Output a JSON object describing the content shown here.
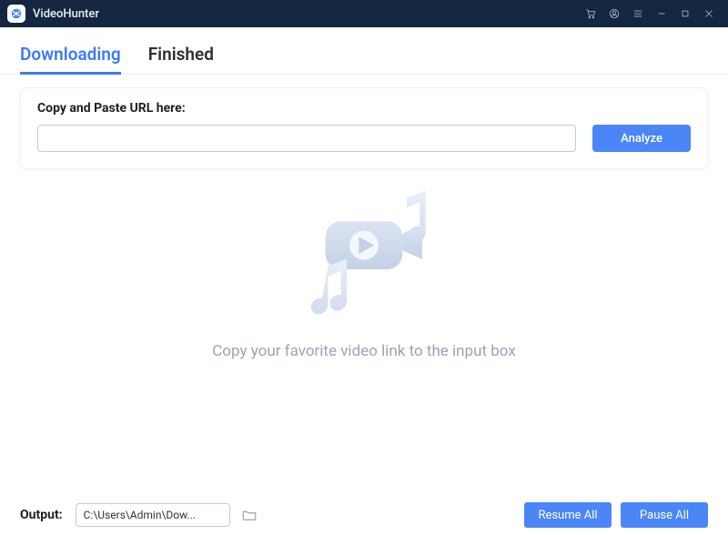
{
  "app": {
    "title": "VideoHunter"
  },
  "tabs": {
    "downloading": "Downloading",
    "finished": "Finished",
    "active": "downloading"
  },
  "urlbox": {
    "label": "Copy and Paste URL here:",
    "value": "",
    "analyze_label": "Analyze"
  },
  "empty": {
    "text": "Copy your favorite video link to the input box"
  },
  "footer": {
    "output_label": "Output:",
    "output_path": "C:\\Users\\Admin\\Dow...",
    "resume_label": "Resume All",
    "pause_label": "Pause All"
  },
  "colors": {
    "accent": "#4b86f6",
    "titlebar": "#142640"
  }
}
